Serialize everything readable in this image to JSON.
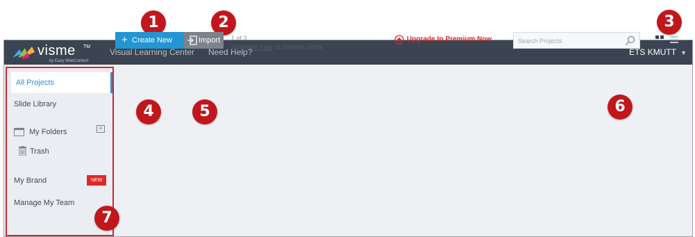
{
  "header": {
    "logo_text": "visme",
    "logo_tm": "TM",
    "logo_sub": "by Easy WebContent",
    "nav": [
      {
        "label": "Visual Learning Center"
      },
      {
        "label": "Need Help?"
      }
    ],
    "user_name": "ETS KMUTT",
    "colors": {
      "bar": "#3b4452",
      "text": "#ffffff"
    }
  },
  "sidebar": {
    "items": [
      {
        "label": "All Projects",
        "active": true
      },
      {
        "label": "Slide Library"
      },
      {
        "label": "My Folders",
        "icon": "folder-icon",
        "action_icon": "add-folder-icon"
      },
      {
        "label": "Trash",
        "icon": "trash-icon"
      },
      {
        "label": "My Brand",
        "badge": "NEW"
      },
      {
        "label": "Manage My Team"
      }
    ],
    "highlight_color": "#d3252d"
  },
  "toolbar": {
    "create_label": "Create New",
    "import_label": "Import",
    "usage_count": "1 of 3",
    "limit_link": "Upgrade now",
    "limit_suffix": " to remove limits",
    "upgrade_label": "Upgrade to Premium Now",
    "search_placeholder": "Search Projects",
    "colors": {
      "create": "#2196d3",
      "import": "#7c838c",
      "upgrade": "#d42b2b"
    }
  },
  "markers": [
    "1",
    "2",
    "3",
    "4",
    "5",
    "6",
    "7"
  ]
}
